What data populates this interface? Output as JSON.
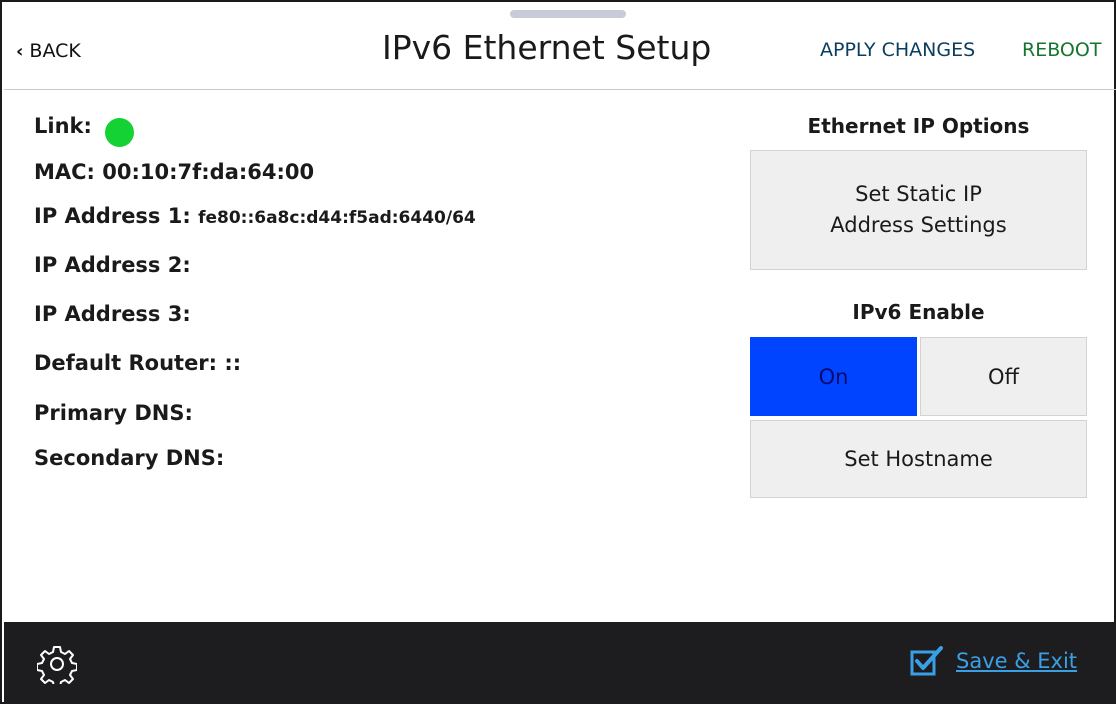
{
  "header": {
    "back_label": "BACK",
    "title": "IPv6 Ethernet Setup",
    "apply_label": "APPLY CHANGES",
    "reboot_label": "REBOOT"
  },
  "info": {
    "link_label": "Link:",
    "link_status_color": "#14d233",
    "mac_label": "MAC:",
    "mac_value": "00:10:7f:da:64:00",
    "ip1_label": "IP Address 1:",
    "ip1_value": "fe80::6a8c:d44:f5ad:6440/64",
    "ip2_label": "IP Address 2:",
    "ip3_label": "IP Address 3:",
    "router_label": "Default Router:",
    "router_value": "::",
    "primary_dns_label": "Primary DNS:",
    "secondary_dns_label": "Secondary DNS:"
  },
  "options": {
    "title": "Ethernet IP Options",
    "static_button": "Set Static IP Address Settings"
  },
  "ipv6": {
    "title": "IPv6 Enable",
    "on_label": "On",
    "off_label": "Off",
    "selected": "On",
    "hostname_button": "Set Hostname"
  },
  "footer": {
    "settings_icon": "gear-icon",
    "save_label": "Save & Exit",
    "save_icon": "checkbox-checked-icon",
    "save_color": "#3aa0e6"
  }
}
